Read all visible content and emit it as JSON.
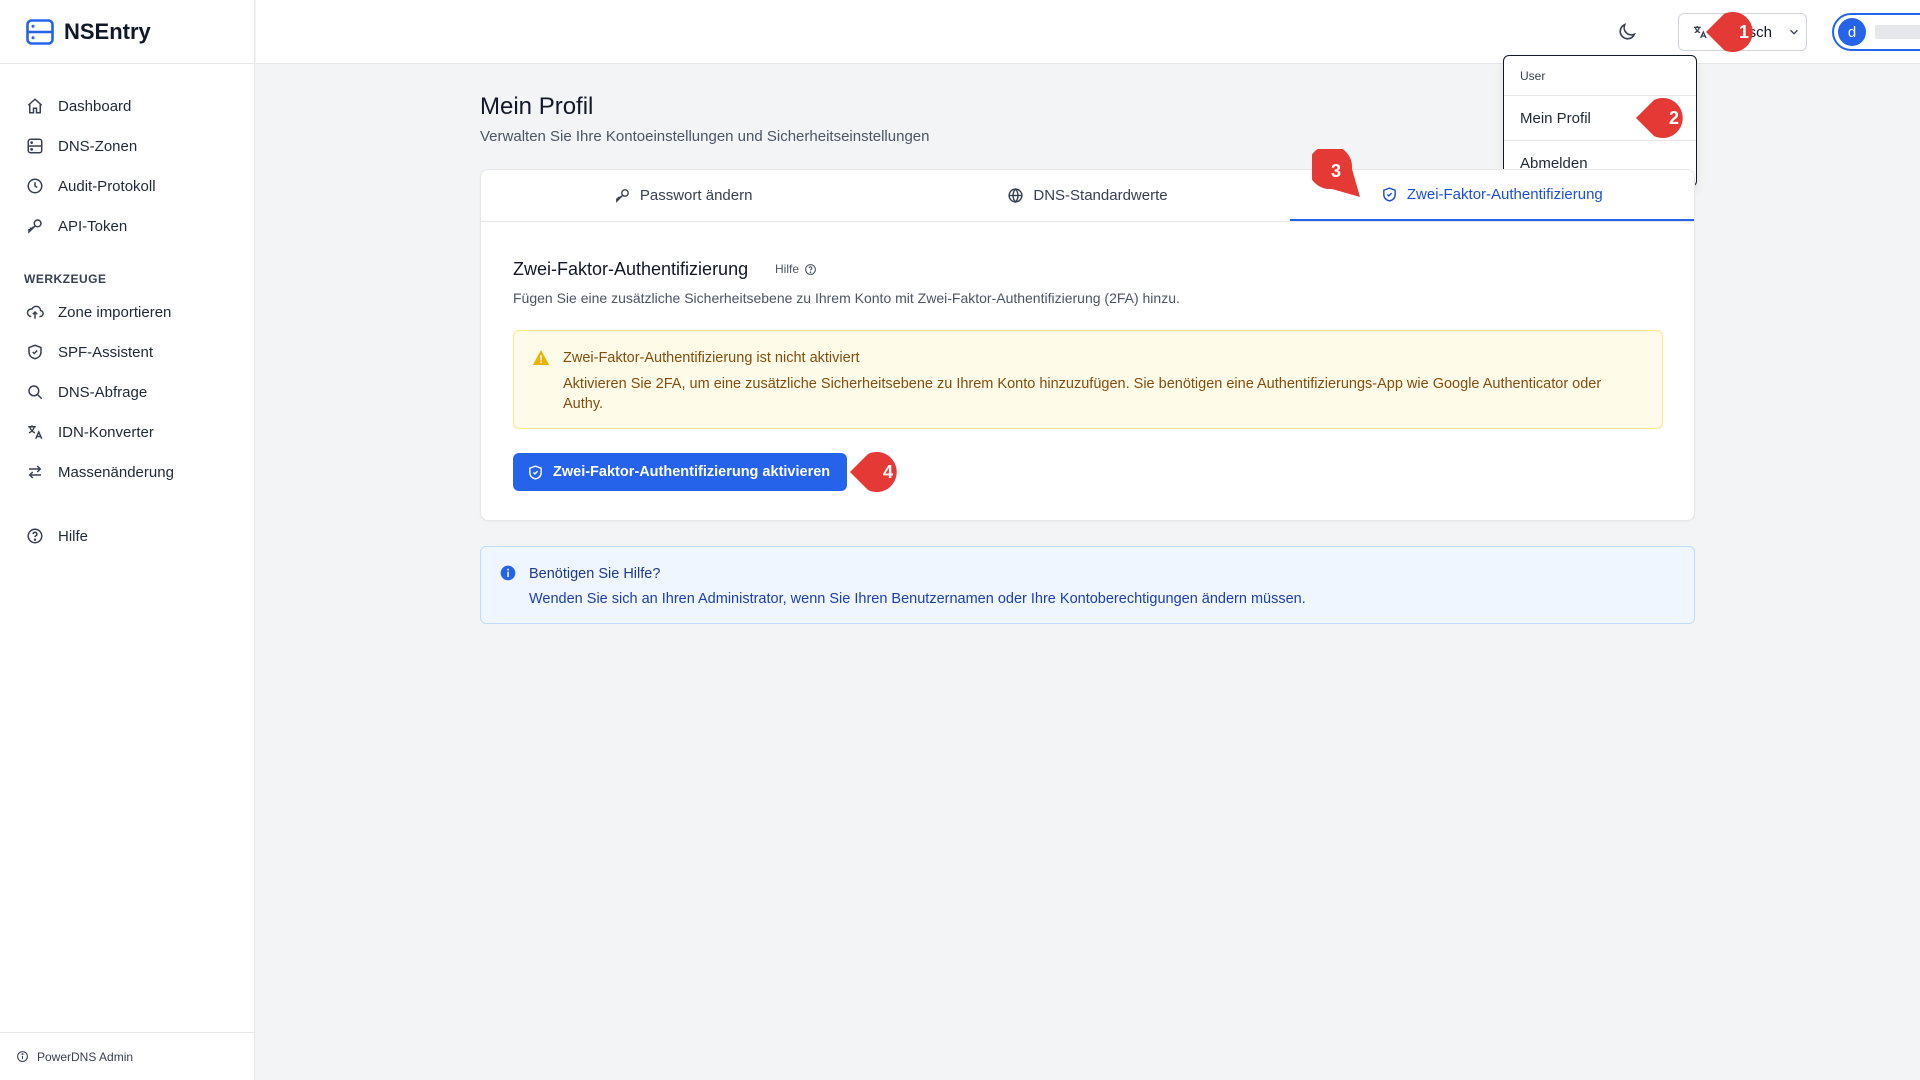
{
  "app": {
    "name": "NSEntry"
  },
  "sidebar": {
    "items": [
      {
        "label": "Dashboard",
        "icon": "home-icon"
      },
      {
        "label": "DNS-Zonen",
        "icon": "server-icon"
      },
      {
        "label": "Audit-Protokoll",
        "icon": "clock-icon"
      },
      {
        "label": "API-Token",
        "icon": "key-icon"
      }
    ],
    "section_label": "WERKZEUGE",
    "tools": [
      {
        "label": "Zone importieren",
        "icon": "cloud-upload-icon"
      },
      {
        "label": "SPF-Assistent",
        "icon": "shield-icon"
      },
      {
        "label": "DNS-Abfrage",
        "icon": "search-icon"
      },
      {
        "label": "IDN-Konverter",
        "icon": "translate-icon"
      },
      {
        "label": "Massenänderung",
        "icon": "arrows-swap-icon"
      }
    ],
    "help": {
      "label": "Hilfe",
      "icon": "help-circle-icon"
    },
    "footer": "PowerDNS Admin"
  },
  "topbar": {
    "language": "Deutsch",
    "avatar_initial": "d",
    "username": "",
    "menu": {
      "label": "User",
      "items": [
        "Mein Profil",
        "Abmelden"
      ]
    }
  },
  "page": {
    "title": "Mein Profil",
    "subtitle": "Verwalten Sie Ihre Kontoeinstellungen und Sicherheitseinstellungen"
  },
  "tabs": [
    {
      "label": "Passwort ändern",
      "icon": "key-icon",
      "active": false
    },
    {
      "label": "DNS-Standardwerte",
      "icon": "globe-icon",
      "active": false
    },
    {
      "label": "Zwei-Faktor-Authentifizierung",
      "icon": "shield-check-icon",
      "active": true
    }
  ],
  "twofa": {
    "title": "Zwei-Faktor-Authentifizierung",
    "help": "Hilfe",
    "description": "Fügen Sie eine zusätzliche Sicherheitsebene zu Ihrem Konto mit Zwei-Faktor-Authentifizierung (2FA) hinzu.",
    "warning_title": "Zwei-Faktor-Authentifizierung ist nicht aktiviert",
    "warning_text": "Aktivieren Sie 2FA, um eine zusätzliche Sicherheitsebene zu Ihrem Konto hinzuzufügen. Sie benötigen eine Authentifizierungs-App wie Google Authenticator oder Authy.",
    "button": "Zwei-Faktor-Authentifizierung aktivieren"
  },
  "info": {
    "title": "Benötigen Sie Hilfe?",
    "text": "Wenden Sie sich an Ihren Administrator, wenn Sie Ihren Benutzernamen oder Ihre Kontoberechtigungen ändern müssen."
  },
  "markers": [
    "1",
    "2",
    "3",
    "4"
  ],
  "colors": {
    "accent": "#2563eb",
    "marker": "#e53935",
    "warning_bg": "#fefce8",
    "info_bg": "#eff6ff"
  }
}
